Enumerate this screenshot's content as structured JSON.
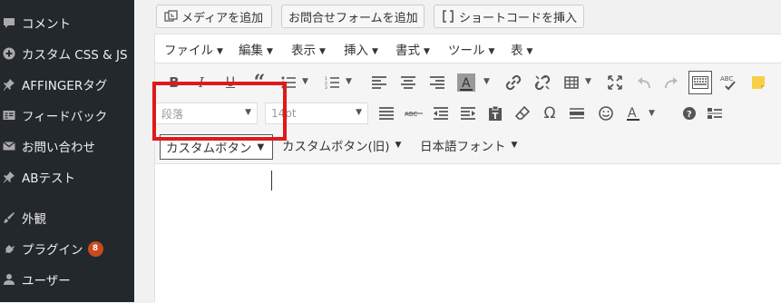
{
  "sidebar": {
    "items": [
      {
        "label": "コメント",
        "icon": "comment-icon"
      },
      {
        "label": "カスタム CSS & JS",
        "icon": "plus-circle-icon"
      },
      {
        "label": "AFFINGERタグ",
        "icon": "pin-icon"
      },
      {
        "label": "フィードバック",
        "icon": "feedback-icon"
      },
      {
        "label": "お問い合わせ",
        "icon": "mail-icon"
      },
      {
        "label": "ABテスト",
        "icon": "pin-icon"
      },
      {
        "label": "外観",
        "icon": "brush-icon"
      },
      {
        "label": "プラグイン",
        "icon": "plugin-icon",
        "badge": "8"
      },
      {
        "label": "ユーザー",
        "icon": "user-icon"
      }
    ]
  },
  "media_buttons": {
    "add_media": "メディアを追加",
    "add_form": "お問合せフォームを追加",
    "insert_shortcode": "ショートコードを挿入"
  },
  "menubar": {
    "items": [
      "ファイル",
      "編集",
      "表示",
      "挿入",
      "書式",
      "ツール",
      "表"
    ]
  },
  "toolbar": {
    "format_select": "段落",
    "fontsize_select": "14pt",
    "custom_button": "カスタムボタン",
    "custom_button_old": "カスタムボタン(旧)",
    "japanese_font": "日本語フォント"
  },
  "colors": {
    "sidebar_bg": "#23282d",
    "highlight": "#e0191a",
    "badge": "#ca4a1f"
  }
}
